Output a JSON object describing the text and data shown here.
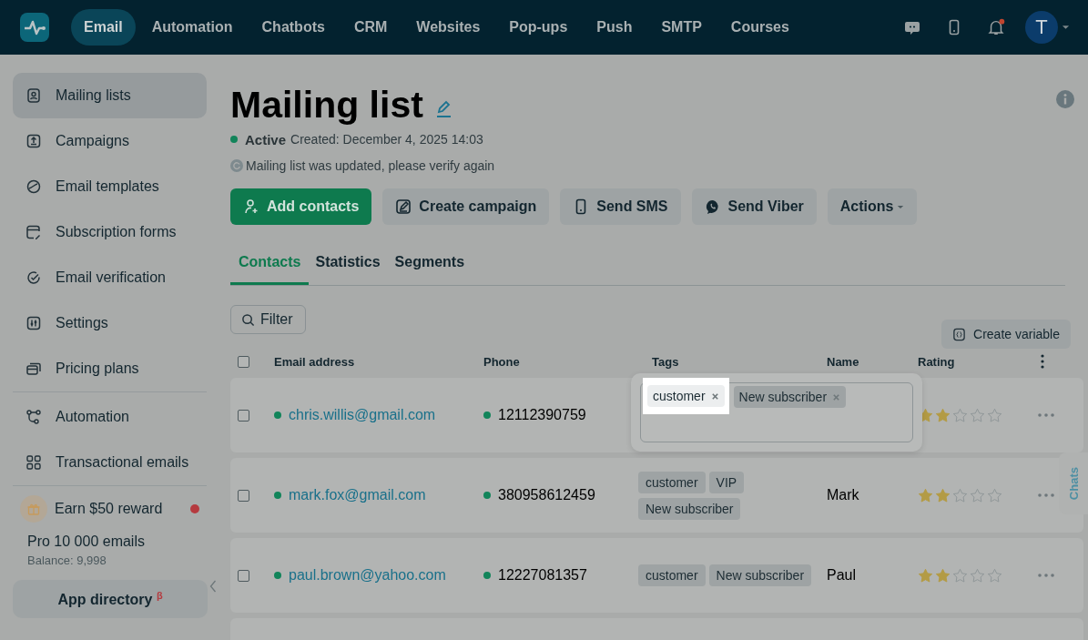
{
  "nav": {
    "items": [
      {
        "label": "Email",
        "selected": true
      },
      {
        "label": "Automation",
        "selected": false
      },
      {
        "label": "Chatbots",
        "selected": false
      },
      {
        "label": "CRM",
        "selected": false
      },
      {
        "label": "Websites",
        "selected": false
      },
      {
        "label": "Pop-ups",
        "selected": false
      },
      {
        "label": "Push",
        "selected": false
      },
      {
        "label": "SMTP",
        "selected": false
      },
      {
        "label": "Courses",
        "selected": false
      }
    ],
    "avatar": "T",
    "notifications_unread": true
  },
  "sidebar": {
    "items": [
      {
        "label": "Mailing lists",
        "selected": true
      },
      {
        "label": "Campaigns",
        "selected": false
      },
      {
        "label": "Email templates",
        "selected": false
      },
      {
        "label": "Subscription forms",
        "selected": false
      },
      {
        "label": "Email verification",
        "selected": false
      },
      {
        "label": "Settings",
        "selected": false
      },
      {
        "label": "Pricing plans",
        "selected": false
      }
    ],
    "tools": [
      {
        "label": "Automation",
        "selected": false
      },
      {
        "label": "Transactional emails",
        "selected": false
      }
    ],
    "reward": {
      "label": "Earn $50 reward",
      "unread": true
    },
    "plan": "Pro 10 000 emails",
    "balance": "Balance: 9,998",
    "app_directory": "App directory $^{β}$"
  },
  "header": {
    "title": "Mailing list",
    "status": "Active",
    "created": "Created: December 4, 2025 14:03",
    "notice": "Mailing list was updated, please verify again"
  },
  "actions": [
    {
      "label": "Add contacts",
      "kind": "primary"
    },
    {
      "label": "Create campaign",
      "kind": "secondary"
    },
    {
      "label": "Send SMS",
      "kind": "secondary"
    },
    {
      "label": "Send Viber",
      "kind": "secondary"
    },
    {
      "label": "Actions",
      "kind": "dropdown"
    }
  ],
  "tabs": [
    {
      "label": "Contacts",
      "selected": true
    },
    {
      "label": "Statistics",
      "selected": false
    },
    {
      "label": "Segments",
      "selected": false
    }
  ],
  "filter": "Filter",
  "create_variable": "Create variable",
  "table": {
    "all_checked": false,
    "columns": [
      "Email address",
      "Phone",
      "Tags",
      "Name",
      "Rating"
    ],
    "rows": [
      {
        "email": "chris.willis@gmail.com",
        "phone": "12112390759",
        "stars": 2,
        "checked": false,
        "editing": true
      },
      {
        "email": "mark.fox@gmail.com",
        "phone": "380958612459",
        "tags": [
          "customer",
          "VIP",
          "New subscriber"
        ],
        "name": "Mark",
        "stars": 2,
        "checked": false,
        "editing": false
      },
      {
        "email": "paul.brown@yahoo.com",
        "phone": "12227081357",
        "tags": [
          "customer",
          "New subscriber"
        ],
        "name": "Paul",
        "stars": 2,
        "checked": false,
        "editing": false
      }
    ]
  },
  "tag_editor": {
    "tags": [
      {
        "label": "customer",
        "highlighted": true
      },
      {
        "label": "New subscriber",
        "highlighted": false
      }
    ]
  },
  "chats_tab": "Chats"
}
